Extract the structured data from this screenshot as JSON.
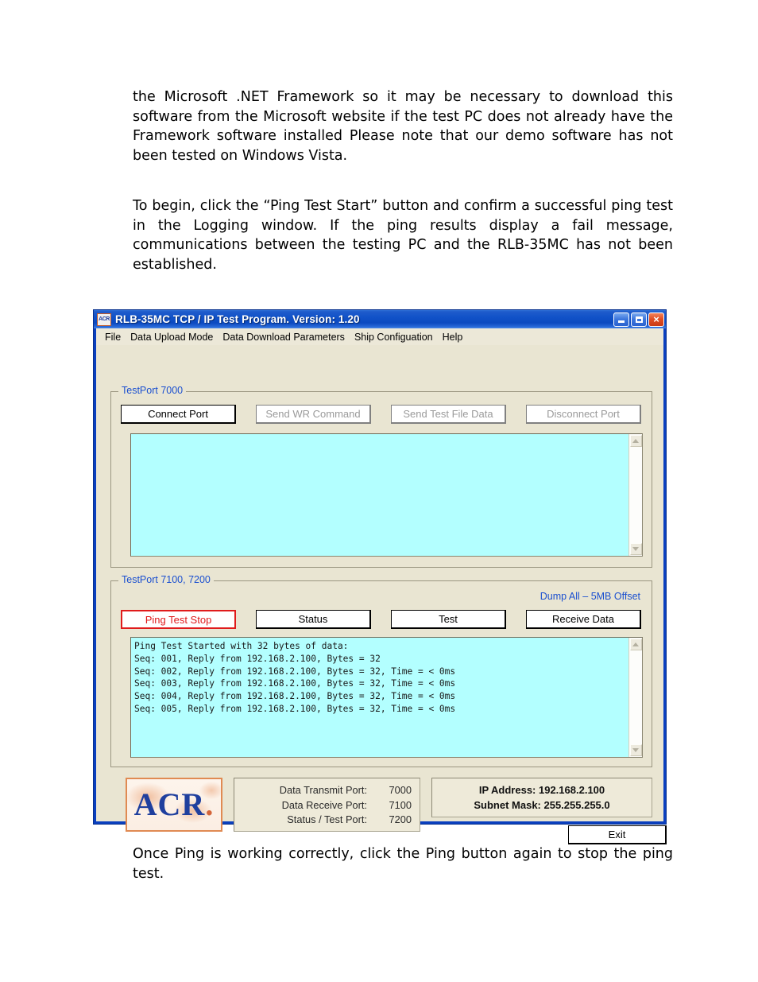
{
  "document": {
    "paragraph_1": "the Microsoft .NET Framework so it may be necessary to download this software from the Microsoft website if the test PC does not already have the Framework software installed   Please note that our demo software has not been tested on Windows Vista.",
    "paragraph_2": "To begin, click the “Ping Test Start” button and confirm a successful ping test in the Logging window. If the ping results display a fail message, communications between the testing PC and the RLB-35MC has not been established.",
    "paragraph_3": "Once Ping is working correctly, click the Ping button again to stop the ping test."
  },
  "window": {
    "title": "RLB-35MC TCP / IP Test Program. Version: 1.20",
    "icon_label": "ACR",
    "titlebar_color": "#0b49c0",
    "background_color": "#e9e5d2",
    "controls": {
      "minimize": "minimize-icon",
      "maximize": "maximize-icon",
      "close": "×"
    }
  },
  "menu": {
    "items": [
      {
        "label": "File"
      },
      {
        "label": "Data Upload Mode"
      },
      {
        "label": "Data Download Parameters"
      },
      {
        "label": "Ship Configuation"
      },
      {
        "label": "Help"
      }
    ]
  },
  "group_1": {
    "label": "TestPort 7000",
    "label_color": "#1a4fd0",
    "buttons": [
      {
        "label": "Connect Port",
        "state": "enabled"
      },
      {
        "label": "Send WR Command",
        "state": "disabled"
      },
      {
        "label": "Send Test File Data",
        "state": "disabled"
      },
      {
        "label": "Disconnect Port",
        "state": "disabled"
      }
    ],
    "log_text": "",
    "log_background": "#b3ffff"
  },
  "group_2": {
    "label": "TestPort 7100, 7200",
    "label_color": "#1a4fd0",
    "dump_label": "Dump All – 5MB Offset",
    "dump_label_color": "#1a4fd0",
    "buttons": [
      {
        "label": "Ping Test Stop",
        "state": "active",
        "color": "#e01b1b"
      },
      {
        "label": "Status",
        "state": "enabled"
      },
      {
        "label": "Test",
        "state": "enabled"
      },
      {
        "label": "Receive Data",
        "state": "enabled"
      }
    ],
    "log_text": "Ping Test Started with 32 bytes of data:\nSeq: 001, Reply from 192.168.2.100, Bytes = 32\nSeq: 002, Reply from 192.168.2.100, Bytes = 32, Time = < 0ms\nSeq: 003, Reply from 192.168.2.100, Bytes = 32, Time = < 0ms\nSeq: 004, Reply from 192.168.2.100, Bytes = 32, Time = < 0ms\nSeq: 005, Reply from 192.168.2.100, Bytes = 32, Time = < 0ms",
    "log_background": "#b3ffff"
  },
  "status_bar": {
    "logo": {
      "text": "ACR",
      "dot": ".",
      "color": "#1f3f9e",
      "border_color": "#e08a52"
    },
    "ports": [
      {
        "label": "Data Transmit Port:",
        "value": "7000"
      },
      {
        "label": "Data Receive Port:",
        "value": "7100"
      },
      {
        "label": "Status / Test Port:",
        "value": "7200"
      }
    ],
    "network": {
      "ip_address": "IP Address: 192.168.2.100",
      "subnet_mask": "Subnet Mask: 255.255.255.0"
    },
    "exit_label": "Exit"
  }
}
